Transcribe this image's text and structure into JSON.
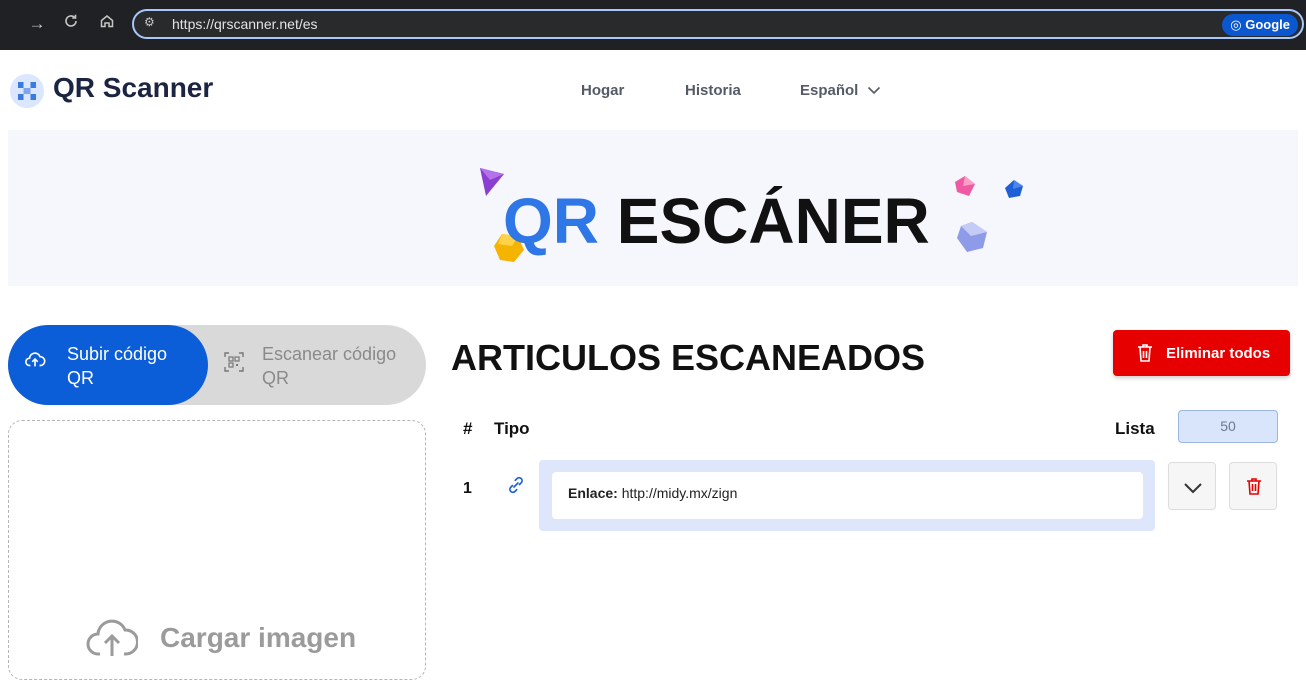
{
  "browser": {
    "url": "https://qrscanner.net/es",
    "google_button": "Google",
    "icons": [
      "forward-icon",
      "reload-icon",
      "home-icon",
      "site-info-icon",
      "google-lens-icon"
    ]
  },
  "header": {
    "brand": "QR Scanner",
    "nav": [
      "Hogar",
      "Historia",
      "Español"
    ]
  },
  "hero": {
    "title_part1": "QR",
    "title_part2": "ESCÁNER"
  },
  "tabs": {
    "upload_label": "Subir código QR",
    "scan_label": "Escanear código QR"
  },
  "upload": {
    "label": "Cargar imagen"
  },
  "scanned": {
    "title": "ARTICULOS ESCANEADOS",
    "delete_all": "Eliminar todos",
    "col_num": "#",
    "col_type": "Tipo",
    "list_label": "Lista",
    "list_value": "50",
    "items": [
      {
        "num": "1",
        "type_icon": "link-icon",
        "label": "Enlace:",
        "value": "http://midy.mx/zign"
      }
    ]
  },
  "colors": {
    "primary": "#0b5ed7",
    "danger": "#e60000",
    "accent_blue": "#2f76e6"
  }
}
